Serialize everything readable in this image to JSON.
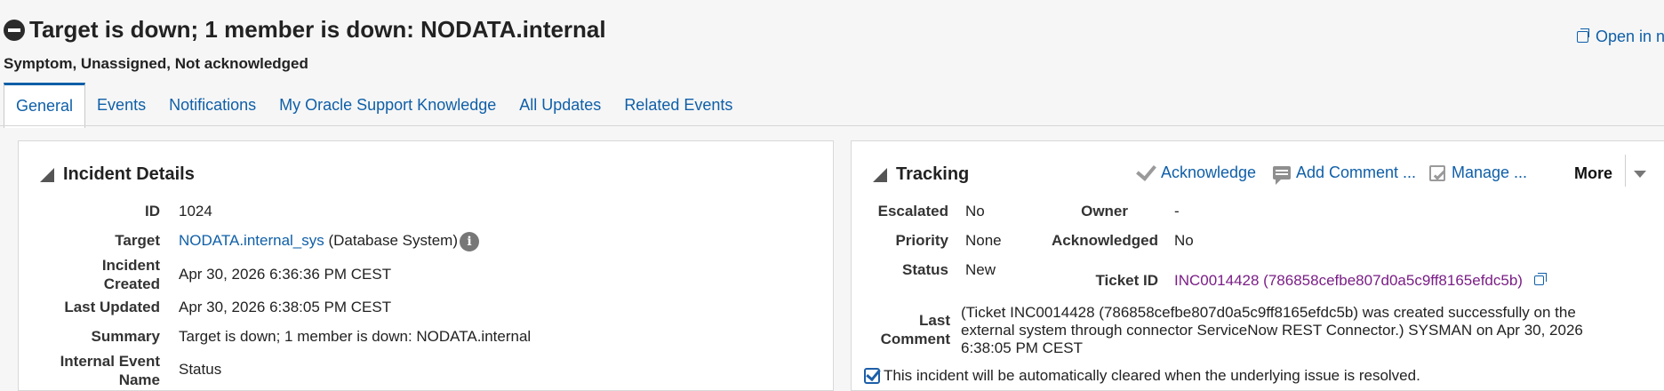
{
  "header": {
    "title": "Target is down; 1 member is down: NODATA.internal",
    "subtitle": "Symptom, Unassigned, Not acknowledged",
    "open_new_label": "Open in n"
  },
  "tabs": [
    {
      "label": "General",
      "active": true
    },
    {
      "label": "Events"
    },
    {
      "label": "Notifications"
    },
    {
      "label": "My Oracle Support Knowledge"
    },
    {
      "label": "All Updates"
    },
    {
      "label": "Related Events"
    }
  ],
  "incident_details": {
    "title": "Incident Details",
    "id_label": "ID",
    "id_value": "1024",
    "target_label": "Target",
    "target_link": "NODATA.internal_sys",
    "target_type": "(Database System)",
    "created_label_1": "Incident",
    "created_label_2": "Created",
    "created_value": "Apr 30, 2026 6:36:36 PM CEST",
    "updated_label": "Last Updated",
    "updated_value": "Apr 30, 2026 6:38:05 PM CEST",
    "summary_label": "Summary",
    "summary_value": "Target is down; 1 member is down: NODATA.internal",
    "event_name_label_1": "Internal Event",
    "event_name_label_2": "Name",
    "event_name_value": "Status"
  },
  "tracking": {
    "title": "Tracking",
    "actions": {
      "acknowledge": "Acknowledge",
      "add_comment": "Add Comment ...",
      "manage": "Manage ...",
      "more": "More"
    },
    "escalated_label": "Escalated",
    "escalated_value": "No",
    "owner_label": "Owner",
    "owner_value": "-",
    "priority_label": "Priority",
    "priority_value": "None",
    "acknowledged_label": "Acknowledged",
    "acknowledged_value": "No",
    "status_label": "Status",
    "status_value": "New",
    "ticket_label": "Ticket ID",
    "ticket_value": "INC0014428 (786858cefbe807d0a5c9ff8165efdc5b)",
    "last_comment_label_1": "Last",
    "last_comment_label_2": "Comment",
    "last_comment_line1": "(Ticket INC0014428 (786858cefbe807d0a5c9ff8165efdc5b) was created successfully on the",
    "last_comment_line2": "external system through connector ServiceNow REST Connector.) SYSMAN on Apr 30, 2026",
    "last_comment_line3": "6:38:05 PM CEST",
    "auto_clear_text": "This incident will be automatically cleared when the underlying issue is resolved."
  },
  "colors": {
    "link": "#0f5fa8",
    "visited_link": "#7a1e86",
    "background": "#f6f6f6"
  }
}
